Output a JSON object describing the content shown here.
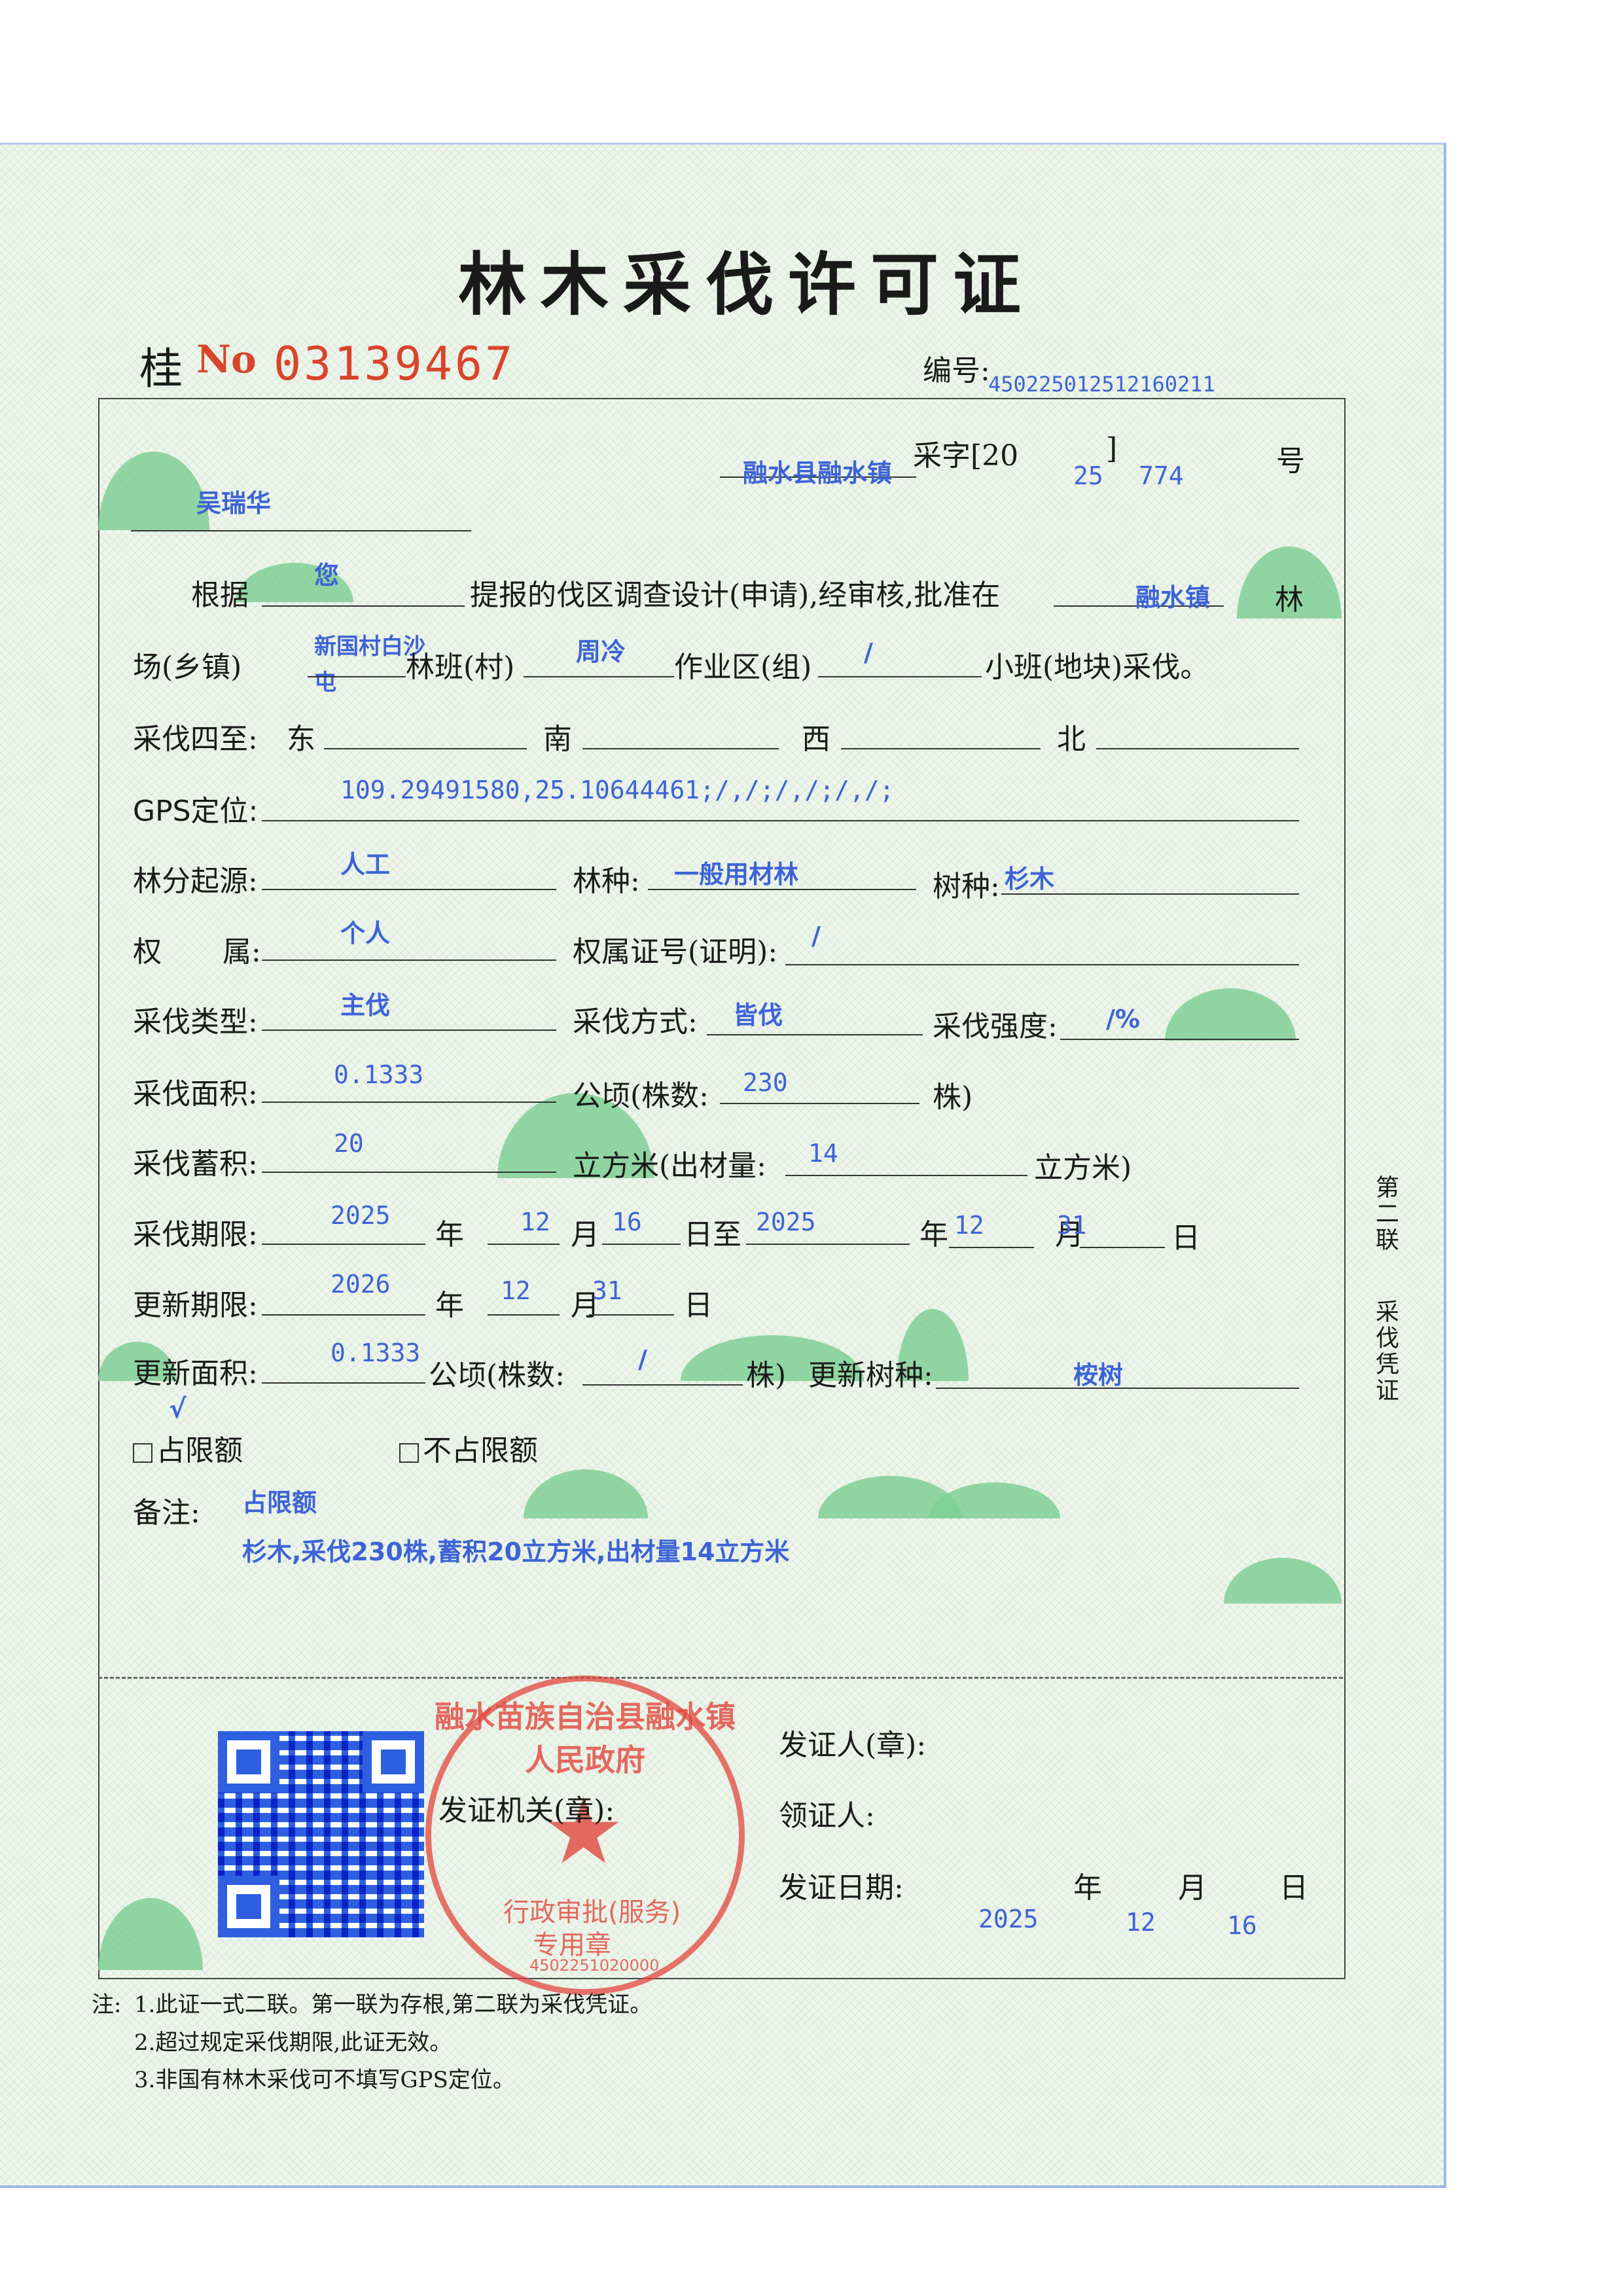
{
  "header": {
    "title": "林木采伐许可证",
    "province": "桂",
    "no_label": "No",
    "no_value": "03139467",
    "serial_label": "编号:",
    "serial_value": "450225012512160211"
  },
  "permit": {
    "issuer_unit": "融水县融水镇",
    "cai_zi_label": "采字[20",
    "cai_zi_bracket": "]",
    "year_code": "25",
    "number": "774",
    "hao_label": "号",
    "holder_name": "吴瑞华"
  },
  "body": {
    "genju": "根据",
    "applicant": "您",
    "mid_text": "提报的伐区调查设计(申请),经审核,批准在",
    "forest_farm": "融水镇",
    "lin": "林",
    "chang_label": "场(乡镇)",
    "township_value_1": "新国村白沙",
    "township_value_2": "屯",
    "linban_label": "林班(村)",
    "linban_value": "周冷",
    "zuoye_label": "作业区(组)",
    "zuoye_value": "/",
    "xiaoban_label": "小班(地块)采伐。"
  },
  "fields": {
    "boundary_label": "采伐四至:",
    "east": "东",
    "south": "南",
    "west": "西",
    "north": "北",
    "gps_label": "GPS定位:",
    "gps_value": "109.29491580,25.10644461;/,/;/,/;/,/;",
    "origin_label": "林分起源:",
    "origin_value": "人工",
    "forest_type_label": "林种:",
    "forest_type_value": "一般用材林",
    "species_label": "树种:",
    "species_value": "杉木",
    "ownership_label_1": "权",
    "ownership_label_2": "属:",
    "ownership_value": "个人",
    "cert_label": "权属证号(证明):",
    "cert_value": "/",
    "cut_type_label": "采伐类型:",
    "cut_type_value": "主伐",
    "cut_method_label": "采伐方式:",
    "cut_method_value": "皆伐",
    "intensity_label": "采伐强度:",
    "intensity_value": "/%",
    "area_label": "采伐面积:",
    "area_value": "0.1333",
    "area_unit": "公顷(株数:",
    "stems_value": "230",
    "stems_unit": "株)",
    "volume_label": "采伐蓄积:",
    "volume_value": "20",
    "volume_unit": "立方米(出材量:",
    "yield_value": "14",
    "yield_unit": "立方米)",
    "period_label": "采伐期限:",
    "period_start_year": "2025",
    "period_start_month": "12",
    "period_start_day": "16",
    "period_end_year": "2025",
    "period_end_month": "12",
    "period_end_day": "31",
    "year_char": "年",
    "month_char": "月",
    "day_char": "日",
    "zhi_char": "日至",
    "renew_deadline_label": "更新期限:",
    "renew_year": "2026",
    "renew_month": "12",
    "renew_day": "31",
    "renew_area_label": "更新面积:",
    "renew_area_value": "0.1333",
    "renew_area_unit": "公顷(株数:",
    "renew_stems_value": "/",
    "renew_stems_unit": "株)",
    "renew_species_label": "更新树种:",
    "renew_species_value": "桉树",
    "quota_checked_label": "占限额",
    "quota_unchecked_label": "不占限额",
    "quota_check_mark": "√",
    "remarks_label": "备注:",
    "remarks_line_1": "占限额",
    "remarks_line_2": "杉木,采伐230株,蓄积20立方米,出材量14立方米"
  },
  "footer": {
    "authority_label": "发证机关(章):",
    "issuer_label": "发证人(章):",
    "receiver_label": "领证人:",
    "date_label": "发证日期:",
    "date_year": "2025",
    "date_month": "12",
    "date_day": "16",
    "seal_text": "融水苗族自治县融水镇人民政府",
    "seal_unit": "行政审批(服务)",
    "seal_sub": "专用章",
    "seal_code": "4502251020000",
    "side_label_1": "第二联",
    "side_label_2": "采伐凭证",
    "notes_prefix": "注:",
    "note_1": "1.此证一式二联。第一联为存根,第二联为采伐凭证。",
    "note_2": "2.超过规定采伐期限,此证无效。",
    "note_3": "3.非国有林木采伐可不填写GPS定位。"
  },
  "colors": {
    "paper": "#eef5ea",
    "serial_red": "#d8452b",
    "handwriting_blue": "#3d63d6",
    "seal_red": "#e1463c",
    "hill_green": "#7fcf95"
  }
}
